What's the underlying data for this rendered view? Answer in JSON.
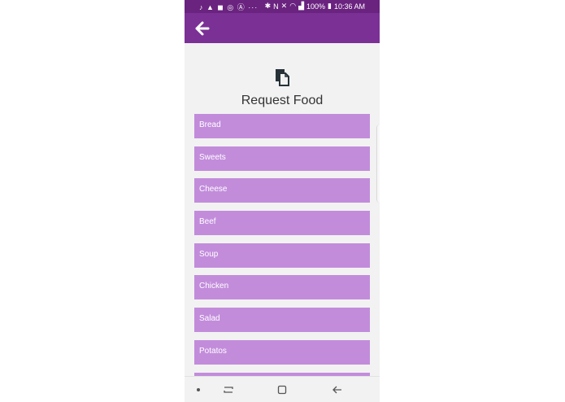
{
  "status_bar": {
    "left_icons": "♪ ▲ ◼ ◎ Ⓐ ···",
    "battery": "100%",
    "time": "10:36 AM"
  },
  "app_bar": {
    "back_icon": "arrow-left-icon"
  },
  "page": {
    "icon": "document-copy-icon",
    "title": "Request Food"
  },
  "food_items": [
    "Bread",
    "Sweets",
    "Cheese",
    "Beef",
    "Soup",
    "Chicken",
    "Salad",
    "Potatos",
    ""
  ],
  "colors": {
    "status_bar": "#6a237f",
    "app_bar": "#7b3096",
    "list_item": "#c28cdb",
    "background": "#f2f2f2"
  }
}
